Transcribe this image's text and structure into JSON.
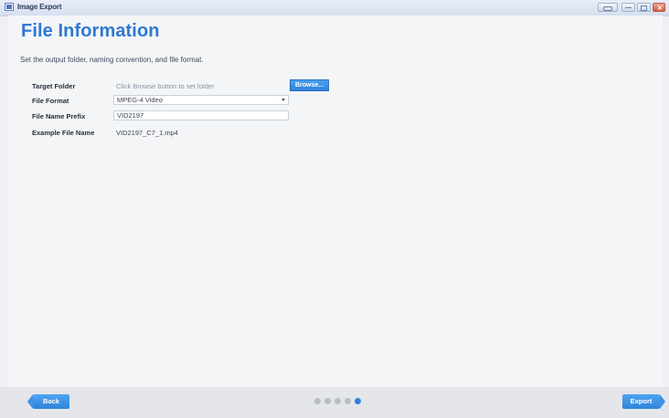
{
  "window": {
    "title": "Image Export"
  },
  "page": {
    "title": "File Information",
    "subtitle": "Set the output folder, naming convention, and file format."
  },
  "form": {
    "target_folder": {
      "label": "Target Folder",
      "placeholder": "Click Browse button to set folder",
      "button_label": "Browse..."
    },
    "file_format": {
      "label": "File Format",
      "value": "MPEG-4 Video"
    },
    "file_name_prefix": {
      "label": "File Name Prefix",
      "value": "VID2197"
    },
    "example_file_name": {
      "label": "Example File Name",
      "value": "VID2197_C7_1.mp4"
    }
  },
  "footer": {
    "back_label": "Back",
    "export_label": "Export",
    "steps_total": 5,
    "current_step": 5
  },
  "colors": {
    "accent": "#2f82db",
    "title": "#2f79d1",
    "inactive_dot": "#b9bec6"
  }
}
